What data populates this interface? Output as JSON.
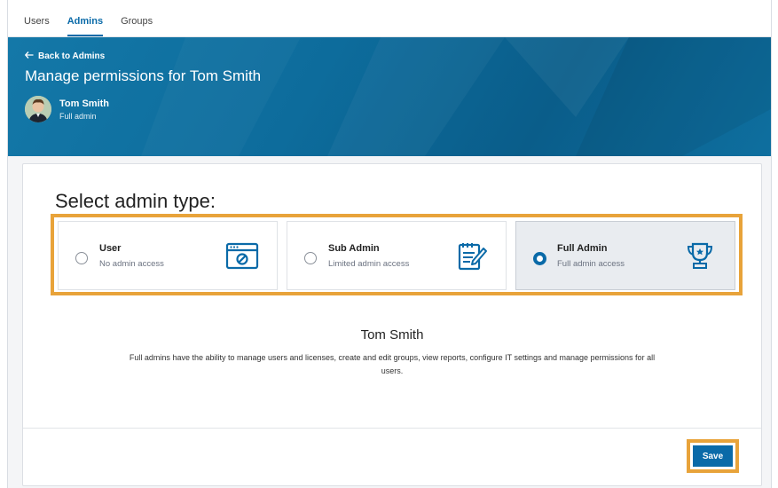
{
  "tabs": [
    {
      "label": "Users",
      "active": false
    },
    {
      "label": "Admins",
      "active": true
    },
    {
      "label": "Groups",
      "active": false
    }
  ],
  "header": {
    "back_label": "Back to Admins",
    "title": "Manage permissions for Tom Smith",
    "user_name": "Tom Smith",
    "user_role": "Full admin"
  },
  "main": {
    "section_title": "Select admin type:",
    "options": [
      {
        "title": "User",
        "subtitle": "No admin access",
        "selected": false,
        "icon": "browser-blocked-icon"
      },
      {
        "title": "Sub Admin",
        "subtitle": "Limited admin access",
        "selected": false,
        "icon": "notepad-pencil-icon"
      },
      {
        "title": "Full Admin",
        "subtitle": "Full admin access",
        "selected": true,
        "icon": "trophy-icon"
      }
    ],
    "detail_name": "Tom Smith",
    "detail_description": "Full admins have the ability to manage users and licenses, create and edit groups, view reports, configure IT settings and manage permissions for all users."
  },
  "footer": {
    "save_label": "Save"
  },
  "colors": {
    "accent": "#0a6aa8",
    "highlight": "#e8a33a",
    "banner": "#0d6c9c"
  }
}
